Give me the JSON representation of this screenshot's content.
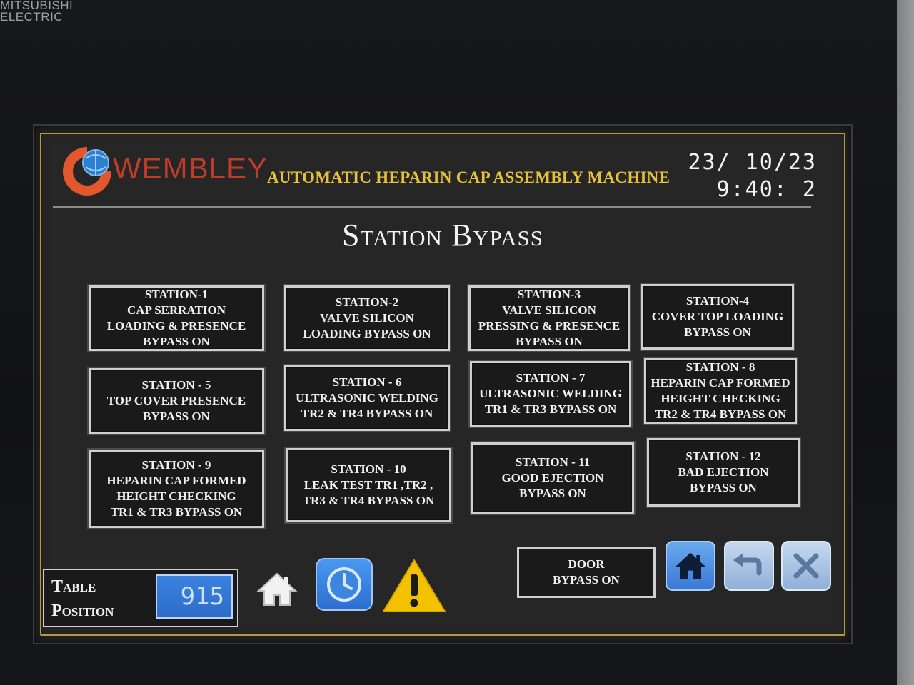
{
  "device": {
    "maker_line1": "MITSUBISHI",
    "maker_line2": "ELECTRIC"
  },
  "header": {
    "brand": "WEMBLEY",
    "title": "AUTOMATIC HEPARIN CAP ASSEMBLY MACHINE",
    "date": "23/ 10/23",
    "time": "9:40: 2"
  },
  "page_title": "Station Bypass",
  "stations": [
    {
      "label": "STATION-1\nCAP SERRATION\nLOADING & PRESENCE\nBYPASS ON"
    },
    {
      "label": "STATION-2\nVALVE SILICON\nLOADING BYPASS ON"
    },
    {
      "label": "STATION-3\nVALVE SILICON\nPRESSING & PRESENCE\nBYPASS ON"
    },
    {
      "label": "STATION-4\nCOVER TOP LOADING\nBYPASS ON"
    },
    {
      "label": "STATION - 5\nTOP COVER PRESENCE\nBYPASS ON"
    },
    {
      "label": "STATION - 6\nULTRASONIC WELDING\nTR2 & TR4 BYPASS ON"
    },
    {
      "label": "STATION - 7\nULTRASONIC WELDING\nTR1 & TR3 BYPASS ON"
    },
    {
      "label": "STATION - 8\nHEPARIN CAP FORMED\nHEIGHT CHECKING\nTR2 & TR4 BYPASS ON"
    },
    {
      "label": "STATION - 9\nHEPARIN CAP FORMED\nHEIGHT CHECKING\nTR1 & TR3 BYPASS ON"
    },
    {
      "label": "STATION - 10\nLEAK TEST TR1 ,TR2 ,\nTR3 & TR4 BYPASS ON"
    },
    {
      "label": "STATION - 11\nGOOD EJECTION\nBYPASS ON"
    },
    {
      "label": "STATION - 12\nBAD EJECTION\nBYPASS ON"
    }
  ],
  "table_position": {
    "label": "Table\nPosition",
    "value": "915"
  },
  "door_bypass": {
    "label": "DOOR\nBYPASS ON"
  },
  "icons": {
    "home": "home-icon",
    "clock": "clock-icon",
    "warning": "warning-icon",
    "back": "back-arrow-icon",
    "close": "close-icon"
  },
  "colors": {
    "title_gold": "#e7c13a",
    "brand_red": "#d9412a",
    "button_blue": "#3a78d6",
    "warning_yellow": "#f2c200"
  }
}
